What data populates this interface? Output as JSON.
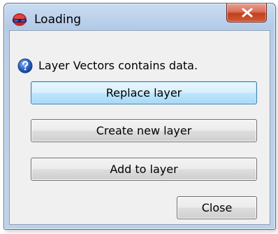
{
  "window": {
    "title": "Loading",
    "app_icon": "loading-app-icon",
    "close_icon": "close-x-icon",
    "close_button_color": "#c9482a"
  },
  "message": {
    "icon": "question-icon",
    "text": "Layer Vectors contains data."
  },
  "buttons": {
    "replace_label": "Replace layer",
    "create_label": "Create new layer",
    "add_label": "Add to layer",
    "close_label": "Close"
  },
  "colors": {
    "title_bar": "#bcd2ea",
    "client_area": "#f0f0f0",
    "default_button": "#bee6fd"
  }
}
